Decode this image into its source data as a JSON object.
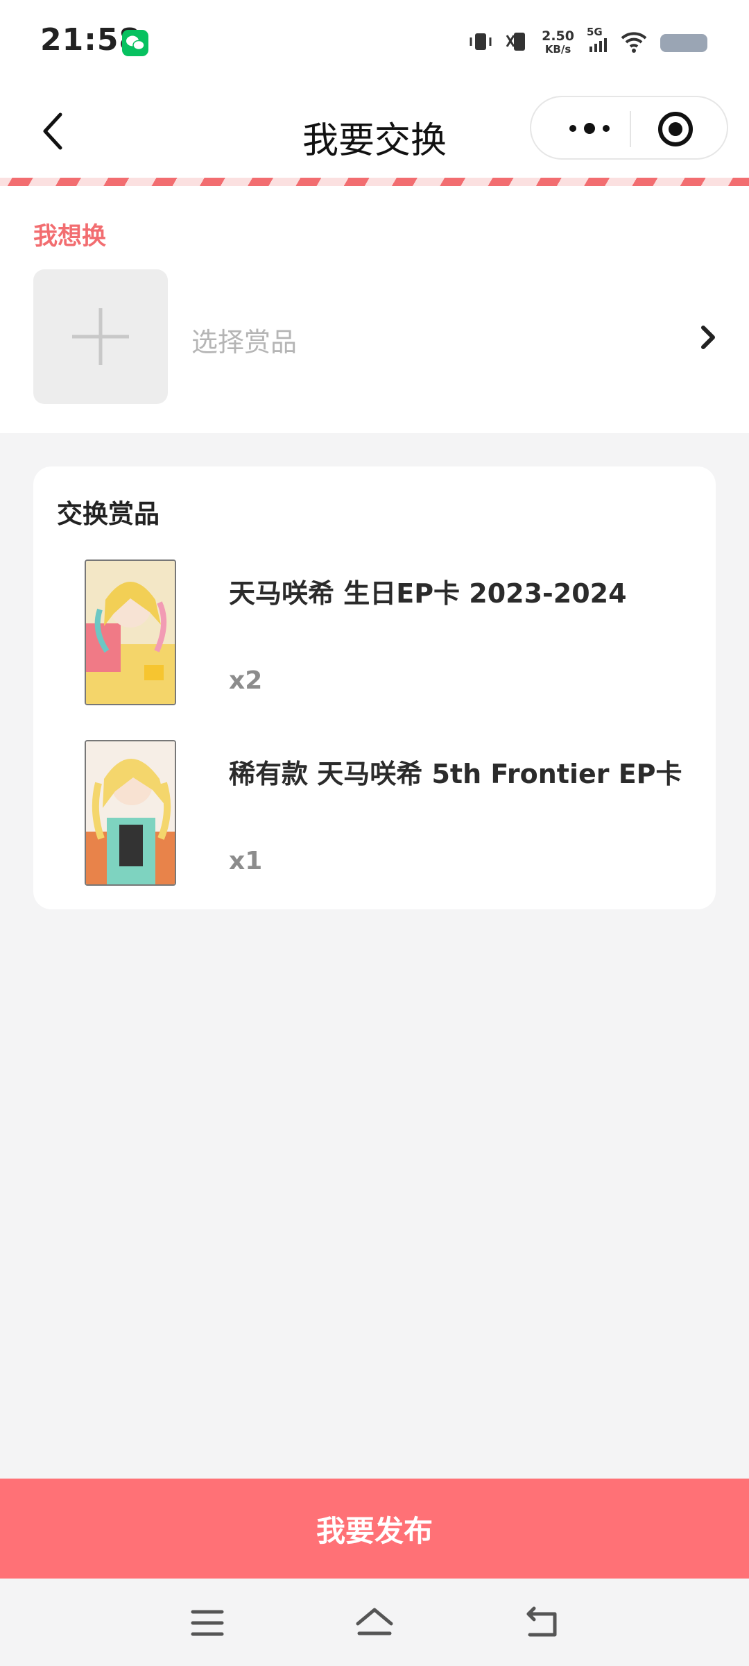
{
  "status_bar": {
    "time": "21:58",
    "net_speed_value": "2.50",
    "net_speed_unit": "KB/s",
    "network_type": "5G",
    "app_notification_icon": "wechat-icon"
  },
  "nav": {
    "title": "我要交换",
    "back_icon": "chevron-left-icon",
    "more_icon": "more-dots-icon",
    "close_icon": "target-close-icon"
  },
  "want": {
    "label": "我想换",
    "placeholder": "选择赏品",
    "add_icon": "plus-icon",
    "arrow_icon": "chevron-right-icon"
  },
  "exchange": {
    "title": "交换赏品",
    "items": [
      {
        "name": "天马咲希 生日EP卡 2023-2024",
        "qty": "x2"
      },
      {
        "name": "稀有款 天马咲希 5th Frontier EP卡",
        "qty": "x1"
      }
    ]
  },
  "publish_button": "我要发布",
  "system_nav": {
    "menu_icon": "menu-icon",
    "home_icon": "home-icon",
    "back_icon": "back-arrow-icon"
  },
  "colors": {
    "accent": "#ff7176",
    "label_pink": "#f26d70",
    "background": "#f4f4f5"
  }
}
